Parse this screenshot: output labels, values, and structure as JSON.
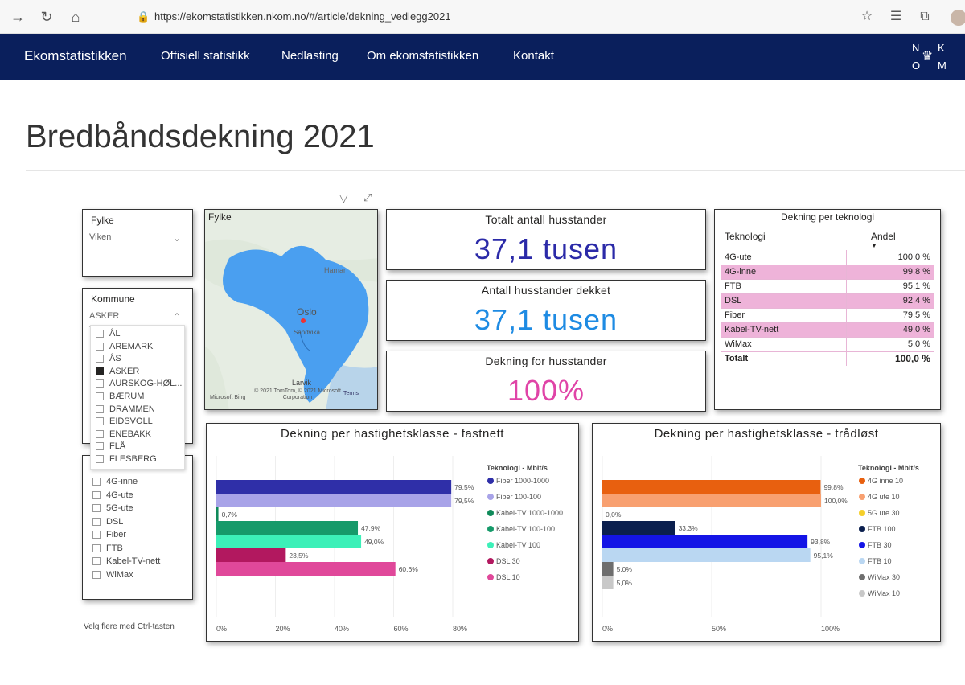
{
  "browser": {
    "url": "https://ekomstatistikken.nkom.no/#/article/dekning_vedlegg2021"
  },
  "nav": {
    "brand": "Ekomstatistikken",
    "items": [
      "Offisiell statistikk",
      "Nedlasting",
      "Om ekomstatistikken",
      "Kontakt"
    ],
    "logo_letters": [
      "N",
      "K",
      "O",
      "M"
    ]
  },
  "page": {
    "title": "Bredbåndsdekning 2021"
  },
  "slicers": {
    "fylke": {
      "title": "Fylke",
      "value": "Viken"
    },
    "kommune": {
      "title": "Kommune",
      "value": "ASKER",
      "options": [
        {
          "label": "ÅL",
          "checked": false
        },
        {
          "label": "AREMARK",
          "checked": false
        },
        {
          "label": "ÅS",
          "checked": false
        },
        {
          "label": "ASKER",
          "checked": true
        },
        {
          "label": "AURSKOG-HØL...",
          "checked": false
        },
        {
          "label": "BÆRUM",
          "checked": false
        },
        {
          "label": "DRAMMEN",
          "checked": false
        },
        {
          "label": "EIDSVOLL",
          "checked": false
        },
        {
          "label": "ENEBAKK",
          "checked": false
        },
        {
          "label": "FLÅ",
          "checked": false
        },
        {
          "label": "FLESBERG",
          "checked": false
        }
      ]
    },
    "teknologi": {
      "options": [
        "4G-inne",
        "4G-ute",
        "5G-ute",
        "DSL",
        "Fiber",
        "FTB",
        "Kabel-TV-nett",
        "WiMax"
      ]
    },
    "hint": "Velg flere med Ctrl-tasten"
  },
  "map": {
    "title": "Fylke",
    "labels": [
      "Hamar",
      "Oslo",
      "Sandvika",
      "Larvik"
    ],
    "credit": "© 2021 TomTom, © 2021 Microsoft Corporation",
    "terms": "Terms",
    "bing": "Microsoft Bing"
  },
  "kpis": [
    {
      "title": "Totalt antall husstander",
      "value": "37,1 tusen",
      "color": "#2b2aa8"
    },
    {
      "title": "Antall husstander dekket",
      "value": "37,1 tusen",
      "color": "#1e8be3"
    },
    {
      "title": "Dekning for husstander",
      "value": "100%",
      "color": "#e044a7"
    }
  ],
  "tech_table": {
    "title": "Dekning per teknologi",
    "col_tech": "Teknologi",
    "col_share": "Andel",
    "rows": [
      {
        "name": "4G-ute",
        "value": "100,0 %",
        "hl": false
      },
      {
        "name": "4G-inne",
        "value": "99,8 %",
        "hl": true
      },
      {
        "name": "FTB",
        "value": "95,1 %",
        "hl": false
      },
      {
        "name": "DSL",
        "value": "92,4 %",
        "hl": true
      },
      {
        "name": "Fiber",
        "value": "79,5 %",
        "hl": false
      },
      {
        "name": "Kabel-TV-nett",
        "value": "49,0 %",
        "hl": true
      },
      {
        "name": "WiMax",
        "value": "5,0 %",
        "hl": false
      }
    ],
    "total_label": "Totalt",
    "total_value": "100,0 %"
  },
  "chart_data": [
    {
      "type": "bar",
      "title": "Dekning per hastighetsklasse - fastnett",
      "legend_title": "Teknologi - Mbit/s",
      "xlim": [
        0,
        80
      ],
      "xticks": [
        "0%",
        "20%",
        "40%",
        "60%",
        "80%"
      ],
      "series": [
        {
          "name": "Fiber 1000-1000",
          "value": 79.5,
          "label": "79,5%",
          "color": "#2f2fa8"
        },
        {
          "name": "Fiber 100-100",
          "value": 79.5,
          "label": "79,5%",
          "color": "#a8a3e8"
        },
        {
          "name": "Kabel-TV 1000-1000",
          "value": 0.7,
          "label": "0,7%",
          "color": "#0f8a5a"
        },
        {
          "name": "Kabel-TV 100-100",
          "value": 47.9,
          "label": "47,9%",
          "color": "#169a6a"
        },
        {
          "name": "Kabel-TV 100",
          "value": 49.0,
          "label": "49,0%",
          "color": "#3cf0b8"
        },
        {
          "name": "DSL 30",
          "value": 23.5,
          "label": "23,5%",
          "color": "#b2185f"
        },
        {
          "name": "DSL 10",
          "value": 60.6,
          "label": "60,6%",
          "color": "#e0489a"
        }
      ]
    },
    {
      "type": "bar",
      "title": "Dekning per hastighetsklasse - trådløst",
      "legend_title": "Teknologi - Mbit/s",
      "xlim": [
        0,
        100
      ],
      "xticks": [
        "0%",
        "50%",
        "100%"
      ],
      "series": [
        {
          "name": "4G inne 10",
          "value": 99.8,
          "label": "99,8%",
          "color": "#e8600f"
        },
        {
          "name": "4G ute 10",
          "value": 100.0,
          "label": "100,0%",
          "color": "#f8a070"
        },
        {
          "name": "5G ute 30",
          "value": 0.0,
          "label": "0,0%",
          "color": "#f5cf2a"
        },
        {
          "name": "FTB 100",
          "value": 33.3,
          "label": "33,3%",
          "color": "#0b1f4e"
        },
        {
          "name": "FTB 30",
          "value": 93.8,
          "label": "93,8%",
          "color": "#1414e6"
        },
        {
          "name": "FTB 10",
          "value": 95.1,
          "label": "95,1%",
          "color": "#bad7f2"
        },
        {
          "name": "WiMax 30",
          "value": 5.0,
          "label": "5,0%",
          "color": "#6e6e6e"
        },
        {
          "name": "WiMax 10",
          "value": 5.0,
          "label": "5,0%",
          "color": "#c8c8c8"
        }
      ]
    }
  ]
}
